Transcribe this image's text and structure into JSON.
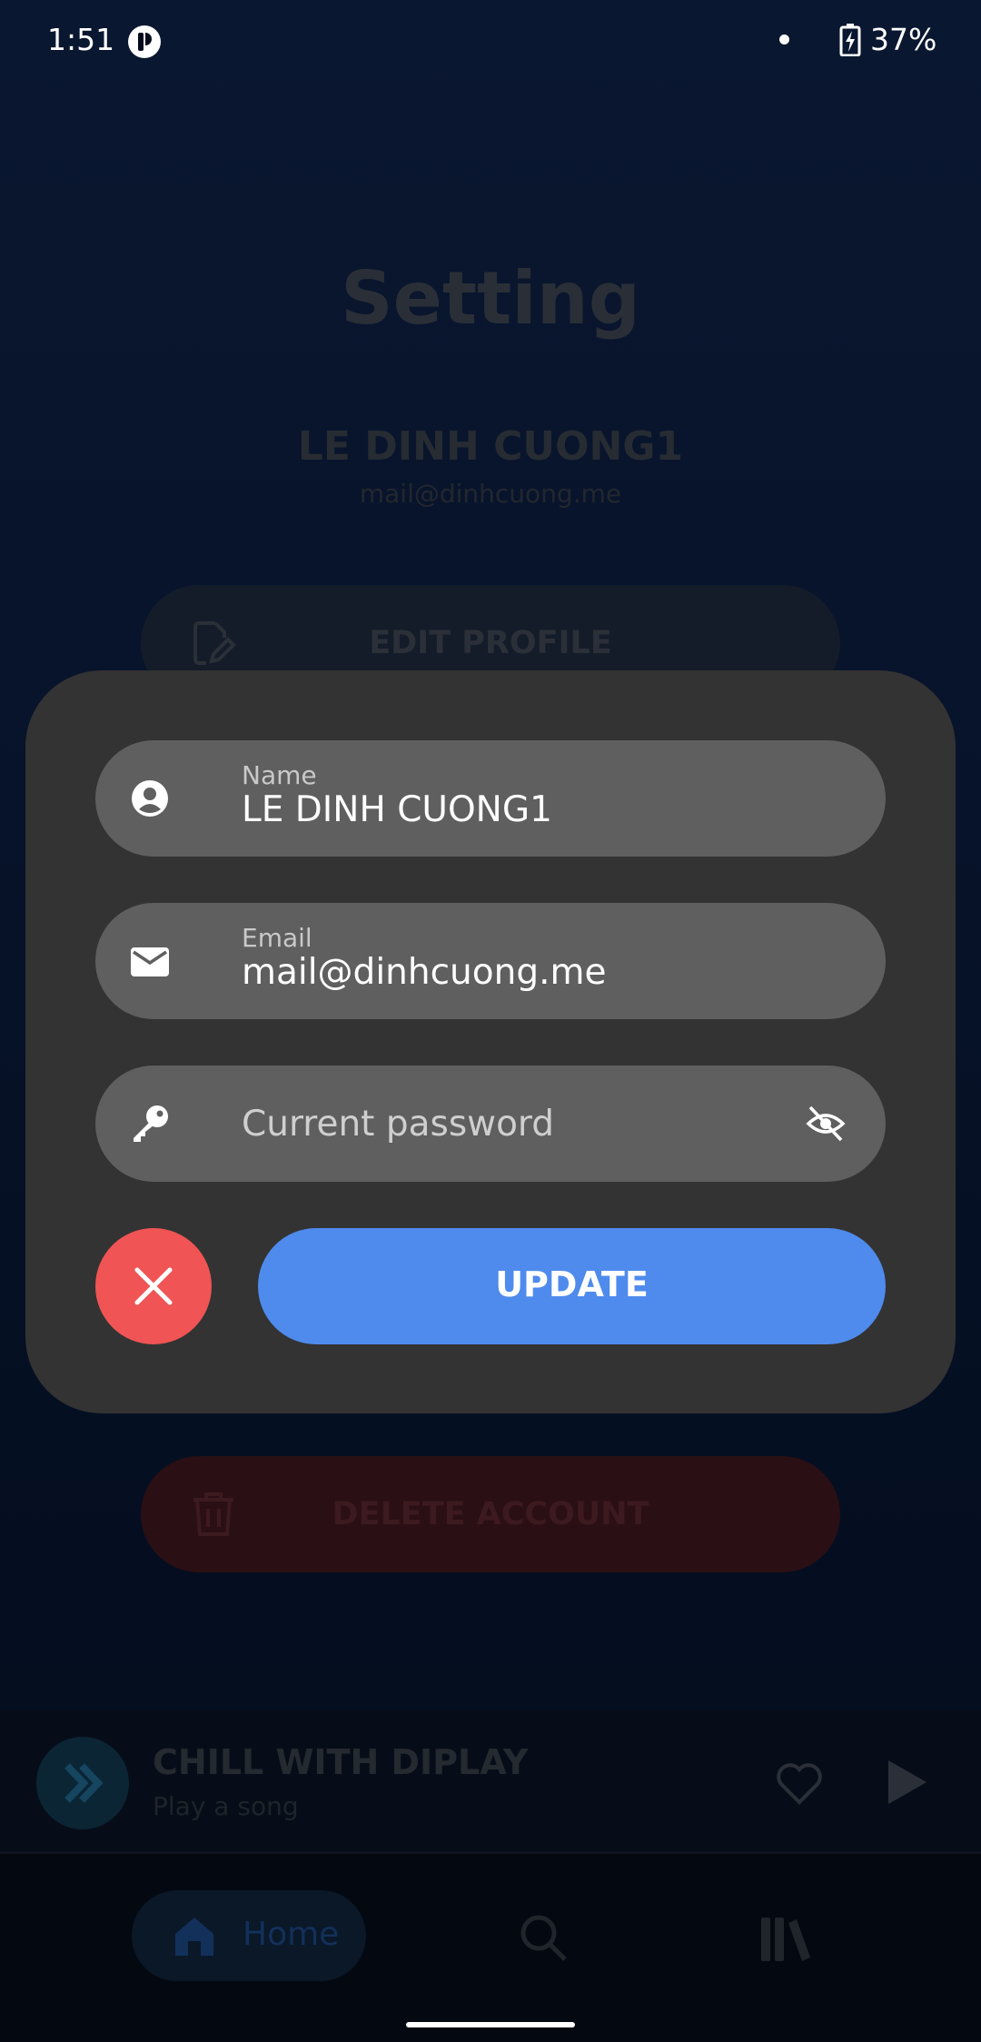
{
  "status_bar": {
    "time": "1:51",
    "battery": "37%"
  },
  "page": {
    "title": "Setting",
    "profile_name": "LE DINH CUONG1",
    "profile_email": "mail@dinhcuong.me",
    "edit_profile_label": "EDIT PROFILE",
    "delete_account_label": "DELETE ACCOUNT"
  },
  "modal": {
    "name": {
      "label": "Name",
      "value": "LE DINH CUONG1"
    },
    "email": {
      "label": "Email",
      "value": "mail@dinhcuong.me"
    },
    "password": {
      "placeholder": "Current password"
    },
    "update_label": "UPDATE"
  },
  "player": {
    "title": "CHILL WITH DIPLAY",
    "subtitle": "Play a song"
  },
  "nav": {
    "home_label": "Home"
  },
  "colors": {
    "accent_blue": "#4f8bec",
    "cancel_red": "#f05454",
    "modal_bg": "#333333",
    "field_bg": "#5f5f5f"
  },
  "icons": [
    "account-circle-icon",
    "mail-icon",
    "key-icon",
    "eye-off-icon",
    "close-icon",
    "edit-icon",
    "trash-icon",
    "heart-icon",
    "play-icon",
    "home-icon",
    "search-icon",
    "library-icon"
  ]
}
